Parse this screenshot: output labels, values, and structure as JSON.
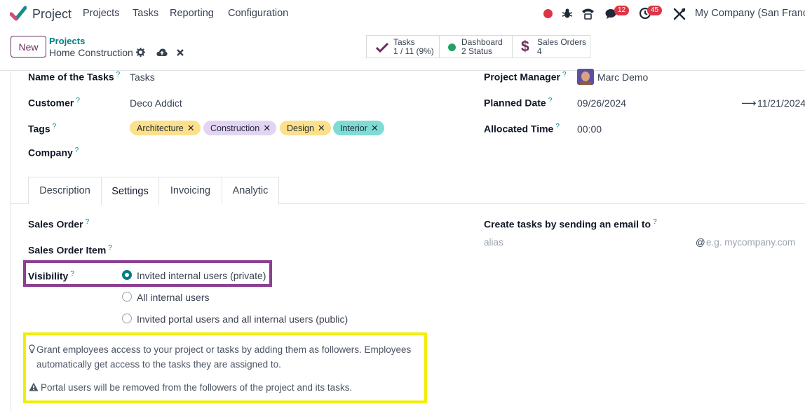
{
  "navbar": {
    "app_name": "Project",
    "menu": [
      "Projects",
      "Tasks",
      "Reporting",
      "Configuration"
    ],
    "messages_count": "12",
    "activities_count": "45",
    "company": "My Company (San Francis"
  },
  "control_panel": {
    "new_label": "New",
    "breadcrumb_parent": "Projects",
    "breadcrumb_current": "Home Construction",
    "smart_buttons": [
      {
        "label": "Tasks",
        "value": "1 / 11 (9%)"
      },
      {
        "label": "Dashboard",
        "value": "2 Status"
      },
      {
        "label": "Sales Orders",
        "value": "4"
      }
    ]
  },
  "form": {
    "name_label": "Name of the Tasks",
    "name_value": "Tasks",
    "customer_label": "Customer",
    "customer_value": "Deco Addict",
    "tags_label": "Tags",
    "tags": [
      {
        "label": "Architecture",
        "color": "#fce08a"
      },
      {
        "label": "Construction",
        "color": "#e4d4f4"
      },
      {
        "label": "Design",
        "color": "#fce08a"
      },
      {
        "label": "Interior",
        "color": "#7fdcd4"
      }
    ],
    "company_label": "Company",
    "manager_label": "Project Manager",
    "manager_value": "Marc Demo",
    "planned_label": "Planned Date",
    "planned_start": "09/26/2024",
    "planned_end": "11/21/2024",
    "allocated_label": "Allocated Time",
    "allocated_value": "00:00",
    "help_mark": "?"
  },
  "tabs": [
    "Description",
    "Settings",
    "Invoicing",
    "Analytic"
  ],
  "settings": {
    "sales_order_label": "Sales Order",
    "sales_order_item_label": "Sales Order Item",
    "visibility_label": "Visibility",
    "visibility_options": [
      "Invited internal users (private)",
      "All internal users",
      "Invited portal users and all internal users (public)"
    ],
    "visibility_selected": 0,
    "email_label": "Create tasks by sending an email to",
    "alias_placeholder": "alias",
    "domain_placeholder": "e.g. mycompany.com",
    "at_sign": "@",
    "info_line1": "Grant employees access to your project or tasks by adding them as followers. Employees",
    "info_line2": "automatically get access to the tasks they are assigned to.",
    "warning_text": "Portal users will be removed from the followers of the project and its tasks."
  },
  "colors": {
    "accent": "#017e84",
    "brand": "#6b2d5c",
    "highlight_purple": "#8c3f93",
    "highlight_yellow": "#f2ee00"
  }
}
